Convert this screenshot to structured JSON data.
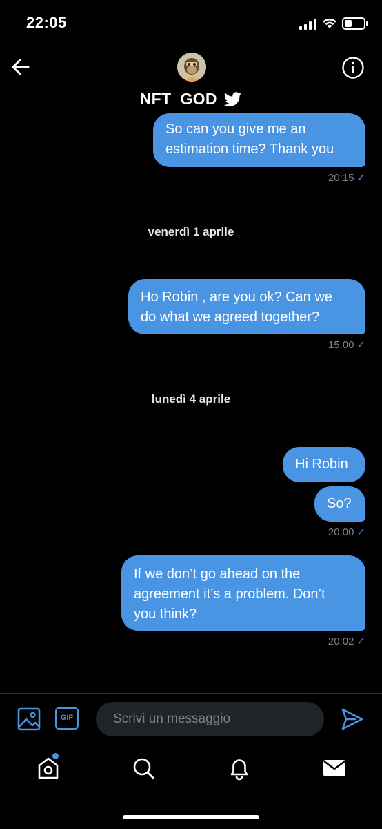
{
  "status_bar": {
    "time": "22:05"
  },
  "header": {
    "contact_name": "NFT_GOD",
    "avatar_icon": "ape-avatar",
    "verified_icon": "twitter-bird-icon"
  },
  "messages": [
    {
      "text_lines": [
        "So can you give me an",
        "estimation time? Thank you"
      ],
      "time": "20:15",
      "check": "✓"
    },
    {
      "text_lines": [
        "Ho Robin , are you ok? Can we",
        "do what we agreed together?"
      ],
      "time": "15:00",
      "check": "✓"
    },
    {
      "text": "Hi Robin"
    },
    {
      "text": "So?",
      "time": "20:00",
      "check": "✓"
    },
    {
      "text_lines": [
        "If we don’t go ahead on the",
        "agreement it’s a problem. Don’t",
        "you think?"
      ],
      "time": "20:02",
      "check": "✓"
    }
  ],
  "date_separators": [
    "venerdì 1 aprile",
    "lunedì 4 aprile"
  ],
  "composer": {
    "placeholder": "Scrivi un messaggio",
    "gif_label": "GIF"
  },
  "tabs": [
    {
      "icon": "home-icon"
    },
    {
      "icon": "search-icon"
    },
    {
      "icon": "bell-icon"
    },
    {
      "icon": "mail-icon"
    }
  ],
  "colors": {
    "accent": "#4a94e4",
    "background": "#000000",
    "muted": "#7d8389"
  }
}
